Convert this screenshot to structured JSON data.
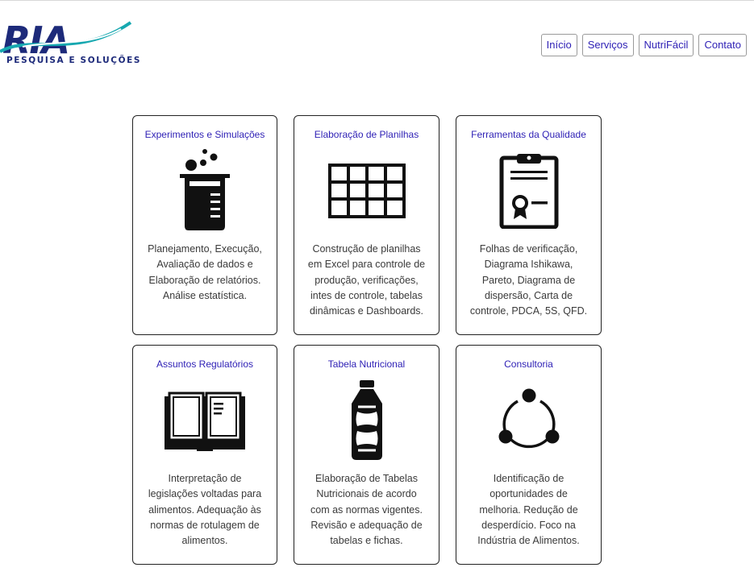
{
  "brand": {
    "logo_text": "RIA",
    "logo_subtitle": "PESQUISA E SOLUÇÕES",
    "colors": {
      "navy": "#1d2a7a",
      "teal": "#17a8b0"
    }
  },
  "nav": [
    {
      "label": "Início"
    },
    {
      "label": "Serviços"
    },
    {
      "label": "NutriFácil"
    },
    {
      "label": "Contato"
    }
  ],
  "accent_color": "#2d1fb5",
  "services": [
    {
      "title": "Experimentos e Simulações",
      "icon": "beaker-icon",
      "desc": "Planejamento, Execução, Avaliação de dados e Elaboração de relatórios. Análise estatística."
    },
    {
      "title": "Elaboração de Planilhas",
      "icon": "spreadsheet-icon",
      "desc": "Construção de planilhas em Excel para controle de produção, verificações, intes de controle, tabelas dinâmicas e Dashboards."
    },
    {
      "title": "Ferramentas da Qualidade",
      "icon": "certificate-clipboard-icon",
      "desc": "Folhas de verificação, Diagrama Ishikawa, Pareto, Diagrama de dispersão, Carta de controle, PDCA, 5S, QFD."
    },
    {
      "title": "Assuntos Regulatórios",
      "icon": "open-book-icon",
      "desc": "Interpretação de legislações voltadas para alimentos. Adequação às normas de rotulagem de alimentos."
    },
    {
      "title": "Tabela Nutricional",
      "icon": "bottle-icon",
      "desc": "Elaboração de Tabelas Nutricionais de acordo com as normas vigentes. Revisão e adequação de tabelas e fichas."
    },
    {
      "title": "Consultoria",
      "icon": "cycle-nodes-icon",
      "desc": "Identificação de oportunidades de melhoria. Redução de desperdício. Foco na Indústria de Alimentos."
    }
  ]
}
